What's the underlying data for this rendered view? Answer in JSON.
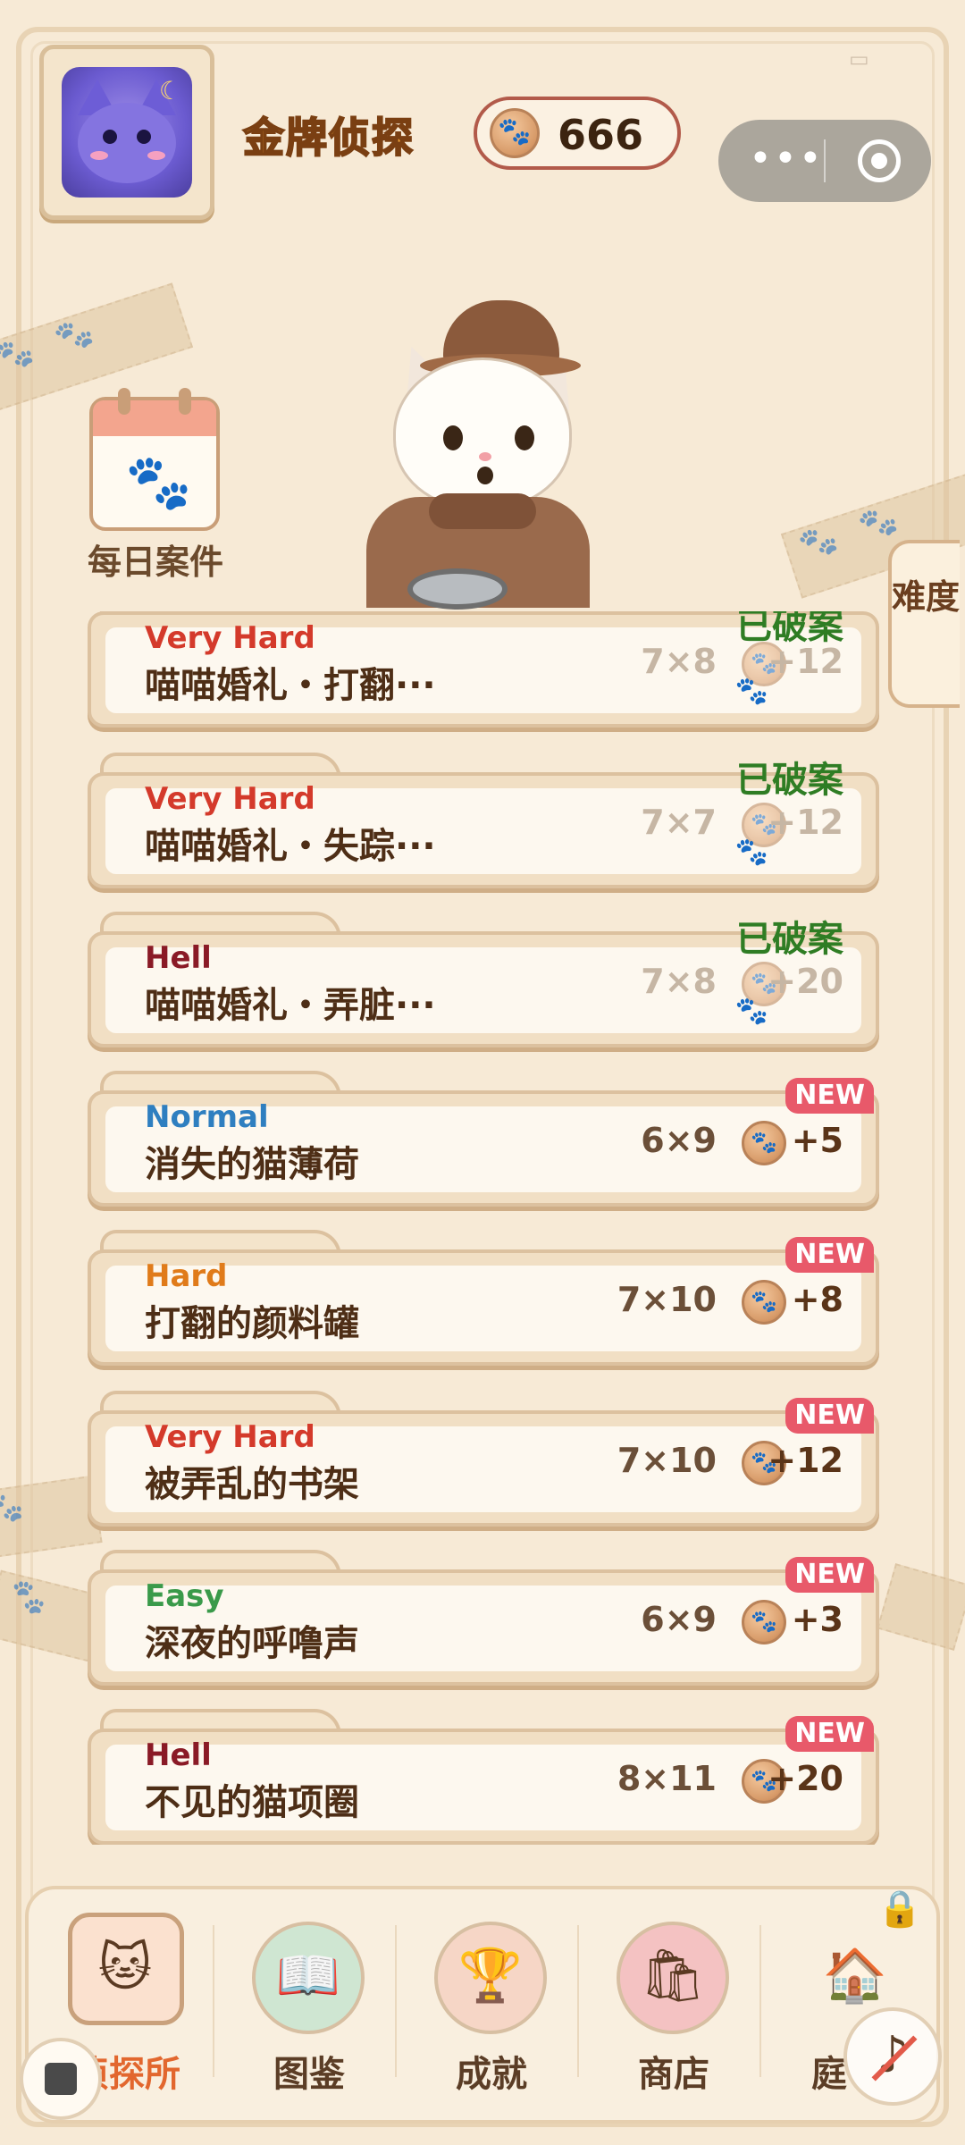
{
  "header": {
    "player_title": "金牌侦探",
    "coins": "666",
    "capsule_dots": "•••"
  },
  "daily": {
    "label": "每日案件"
  },
  "difficulty_tab": {
    "label": "难度"
  },
  "cases": [
    {
      "difficulty": "Very Hard",
      "color": "#d43a2b",
      "name": "喵喵婚礼・打翻···",
      "size": "7×8",
      "reward": "+12",
      "solved": "已破案",
      "is_new": false
    },
    {
      "difficulty": "Very Hard",
      "color": "#d43a2b",
      "name": "喵喵婚礼・失踪···",
      "size": "7×7",
      "reward": "+12",
      "solved": "已破案",
      "is_new": false
    },
    {
      "difficulty": "Hell",
      "color": "#8a1a26",
      "name": "喵喵婚礼・弄脏···",
      "size": "7×8",
      "reward": "+20",
      "solved": "已破案",
      "is_new": false
    },
    {
      "difficulty": "Normal",
      "color": "#2f7fc0",
      "name": "消失的猫薄荷",
      "size": "6×9",
      "reward": "+5",
      "solved": "",
      "is_new": true
    },
    {
      "difficulty": "Hard",
      "color": "#e07b1a",
      "name": "打翻的颜料罐",
      "size": "7×10",
      "reward": "+8",
      "solved": "",
      "is_new": true
    },
    {
      "difficulty": "Very Hard",
      "color": "#d43a2b",
      "name": "被弄乱的书架",
      "size": "7×10",
      "reward": "+12",
      "solved": "",
      "is_new": true
    },
    {
      "difficulty": "Easy",
      "color": "#3a9a4a",
      "name": "深夜的呼噜声",
      "size": "6×9",
      "reward": "+3",
      "solved": "",
      "is_new": true
    },
    {
      "difficulty": "Hell",
      "color": "#8a1a26",
      "name": "不见的猫项圈",
      "size": "8×11",
      "reward": "+20",
      "solved": "",
      "is_new": true
    }
  ],
  "new_badge": "NEW",
  "nav": [
    {
      "label": "侦探所",
      "icon": "detective-cat-icon",
      "active": true
    },
    {
      "label": "图鉴",
      "icon": "book-icon",
      "active": false
    },
    {
      "label": "成就",
      "icon": "trophy-icon",
      "active": false
    },
    {
      "label": "商店",
      "icon": "shopping-bag-icon",
      "active": false
    },
    {
      "label": "庭",
      "icon": "house-icon",
      "active": false
    }
  ]
}
